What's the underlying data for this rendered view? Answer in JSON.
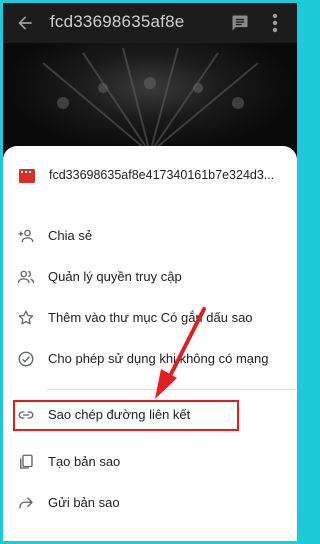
{
  "topbar": {
    "title": "fcd33698635af8e",
    "back_icon": "arrow-back-icon",
    "comment_icon": "comment-icon",
    "more_icon": "more-vert-icon"
  },
  "sheet": {
    "file": {
      "name": "fcd33698635af8e417340161b7e324d3...",
      "icon": "video-file-icon"
    },
    "items": [
      {
        "label": "Chia sẻ",
        "icon": "person-add-icon"
      },
      {
        "label": "Quản lý quyền truy cập",
        "icon": "people-icon"
      },
      {
        "label": "Thêm vào thư mục Có gắn dấu sao",
        "icon": "star-icon"
      },
      {
        "label": "Cho phép sử dụng khi không có mạng",
        "icon": "offline-check-icon"
      },
      {
        "label": "Sao chép đường liên kết",
        "icon": "link-icon"
      },
      {
        "label": "Tạo bản sao",
        "icon": "copy-icon"
      },
      {
        "label": "Gửi bản sao",
        "icon": "share-forward-icon"
      }
    ]
  },
  "colors": {
    "highlight": "#e02020",
    "file_icon": "#d93025",
    "frame_border": "#1dcad8"
  }
}
